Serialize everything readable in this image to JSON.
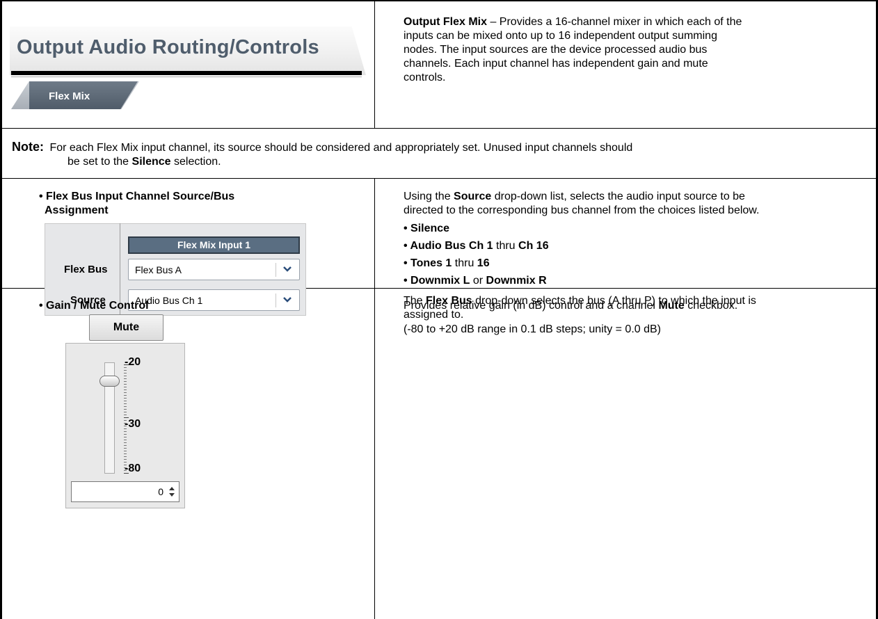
{
  "header": {
    "title": "Output Audio Routing/Controls",
    "subtab": "Flex Mix",
    "description_title": "Output Flex Mix",
    "description_lines": [
      " – Provides a 16-channel mixer in which each of the",
      "inputs can be mixed onto up to 16 independent output summing",
      "nodes. The input sources are the device processed audio bus",
      "channels. Each input channel has independent gain and mute",
      "controls."
    ]
  },
  "note": {
    "label": "Note:",
    "line1": "For each Flex Mix input channel, its source should be considered and appropriately set. Unused input channels should",
    "line2_pre": "be set to the ",
    "line2_bold": "Silence",
    "line2_post": " selection."
  },
  "row1": {
    "heading_line1": "• Flex Bus Input Channel Source/Bus",
    "heading_line2": "Assignment",
    "panel": {
      "header": "Flex Mix Input 1",
      "flex_bus_label": "Flex Bus",
      "flex_bus_value": "Flex Bus A",
      "source_label": "Source",
      "source_value": "Audio Bus Ch 1"
    },
    "desc_line1_pre": "Using the ",
    "desc_line1_bold": "Source",
    "desc_line1_post": " drop-down list, selects the audio input source to be",
    "desc_line2": "directed to the corresponding bus channel from the choices listed below.",
    "bullet1": "• Silence",
    "bullet2_a": "• Audio Bus Ch 1",
    "bullet2_b": " thru ",
    "bullet2_c": "Ch 16",
    "bullet3_a": "• Tones 1",
    "bullet3_b": " thru ",
    "bullet3_c": "16",
    "bullet4_a": "• Downmix L",
    "bullet4_b": " or ",
    "bullet4_c": "Downmix R",
    "desc2_line1_pre": "The ",
    "desc2_line1_bold": "Flex Bus",
    "desc2_line1_post": " drop-down selects the bus (A thru P) to which the input is",
    "desc2_line2": "assigned to."
  },
  "row2": {
    "heading": "• Gain / Mute Control",
    "mute_label": "Mute",
    "scale": {
      "top": "-20",
      "mid": "-30",
      "bottom": "-80"
    },
    "gain_value": "0",
    "gain_level_db": 0,
    "desc_line1_pre": "Provides relative gain (in dB) control and a channel ",
    "desc_line1_bold": "Mute",
    "desc_line1_post": " checkbox.",
    "desc_line2": "(-80 to +20 dB range in 0.1 dB steps; unity = 0.0 dB)"
  }
}
